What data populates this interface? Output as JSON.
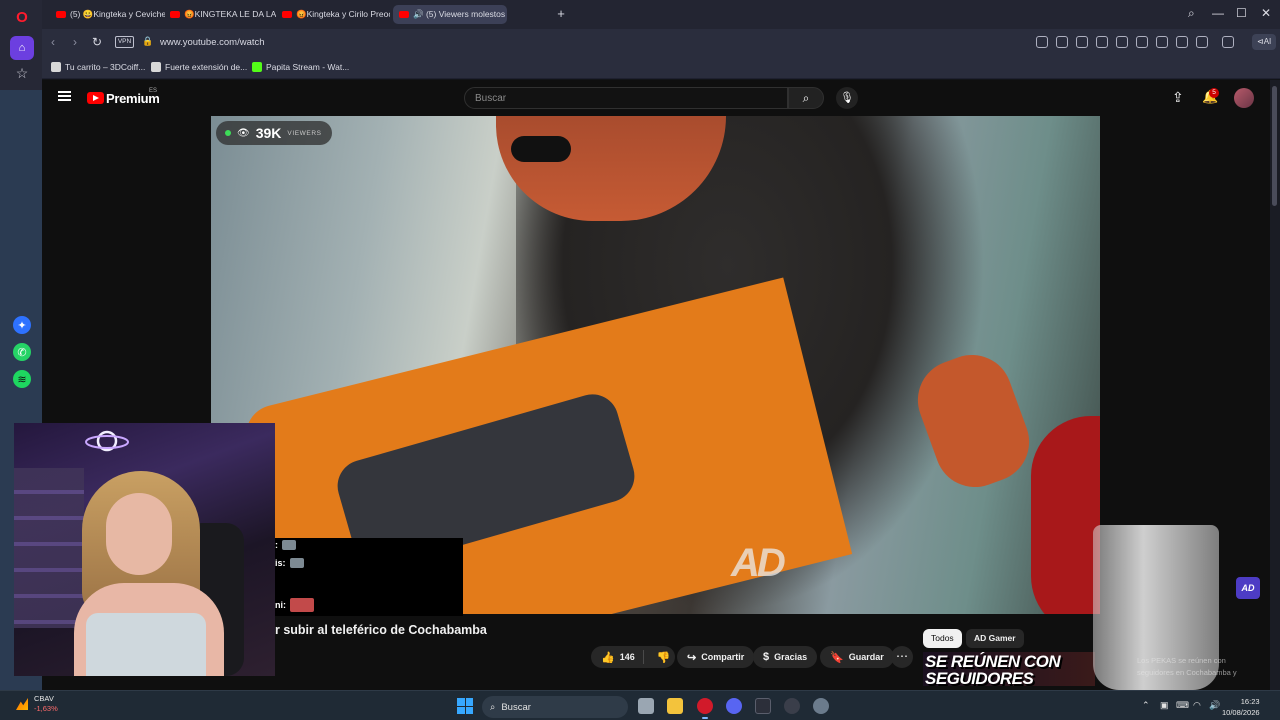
{
  "browser": {
    "tabs": [
      {
        "label": "(5) 😀Kingteka y Cevicher"
      },
      {
        "label": "😡KINGTEKA LE DA LA C"
      },
      {
        "label": "😡Kingteka y Cirilo Preoc"
      },
      {
        "label": "🔊 (5) Viewers molestos c"
      }
    ],
    "new_tab_label": "+",
    "vpn_label": "VPN",
    "url": "www.youtube.com/watch",
    "ai_label": "⊲AI",
    "bookmarks": [
      {
        "label": "Tu carrito – 3DCoiff..."
      },
      {
        "label": "Fuerte extensión de..."
      },
      {
        "label": "Papita Stream - Wat..."
      }
    ]
  },
  "youtube": {
    "brand": "Premium",
    "region": "ES",
    "search_placeholder": "Buscar",
    "notification_count": "5",
    "live_viewers": "39K",
    "viewers_label": "VIEWERS",
    "video_watermark": "AD",
    "video_title": "r subir al teleférico de Cochabamba",
    "actions": {
      "like_count": "146",
      "share_label": "Compartir",
      "thanks_label": "Gracias",
      "save_label": "Guardar"
    },
    "chips": [
      "Todos",
      "AD Gamer"
    ],
    "promo_text_line1": "SE REÚNEN CON",
    "promo_text_line2": "SEGUIDORES",
    "side_logo": "AD",
    "side_news": "Los PEKAS se reúnen con seguidores en Cochabamba y"
  },
  "chat": {
    "lines": [
      {
        "prefix": ":"
      },
      {
        "prefix": "is:"
      },
      {
        "prefix": "ni:"
      }
    ]
  },
  "taskbar": {
    "stock_name": "CBAV",
    "stock_change": "-1,63%",
    "search_label": "Buscar",
    "time": "16:23",
    "date": "10/08/2026"
  }
}
